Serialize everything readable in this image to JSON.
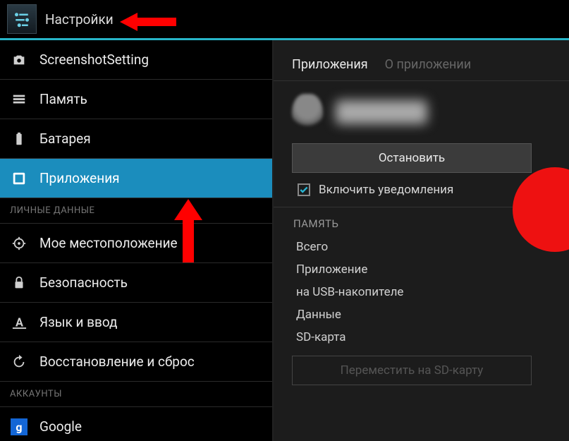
{
  "header": {
    "title": "Настройки"
  },
  "sidebar": {
    "items": [
      {
        "label": "ScreenshotSetting",
        "icon": "camera-icon"
      },
      {
        "label": "Память",
        "icon": "storage-icon"
      },
      {
        "label": "Батарея",
        "icon": "battery-icon"
      },
      {
        "label": "Приложения",
        "icon": "apps-icon",
        "selected": true
      },
      {
        "header": "ЛИЧНЫЕ ДАННЫЕ"
      },
      {
        "label": "Мое местоположение",
        "icon": "location-icon"
      },
      {
        "label": "Безопасность",
        "icon": "lock-icon"
      },
      {
        "label": "Язык и ввод",
        "icon": "language-icon"
      },
      {
        "label": "Восстановление и сброс",
        "icon": "reset-icon"
      },
      {
        "header": "АККАУНТЫ"
      },
      {
        "label": "Google",
        "icon": "google-icon"
      }
    ]
  },
  "right": {
    "tabs": {
      "active": "Приложения",
      "inactive": "О приложении"
    },
    "stop_button": "Остановить",
    "notifications_checkbox": "Включить уведомления",
    "memory": {
      "title": "ПАМЯТЬ",
      "rows": [
        "Всего",
        "Приложение",
        "на USB-накопителе",
        "Данные",
        "SD-карта"
      ]
    },
    "move_button": "Переместить на SD-карту"
  }
}
